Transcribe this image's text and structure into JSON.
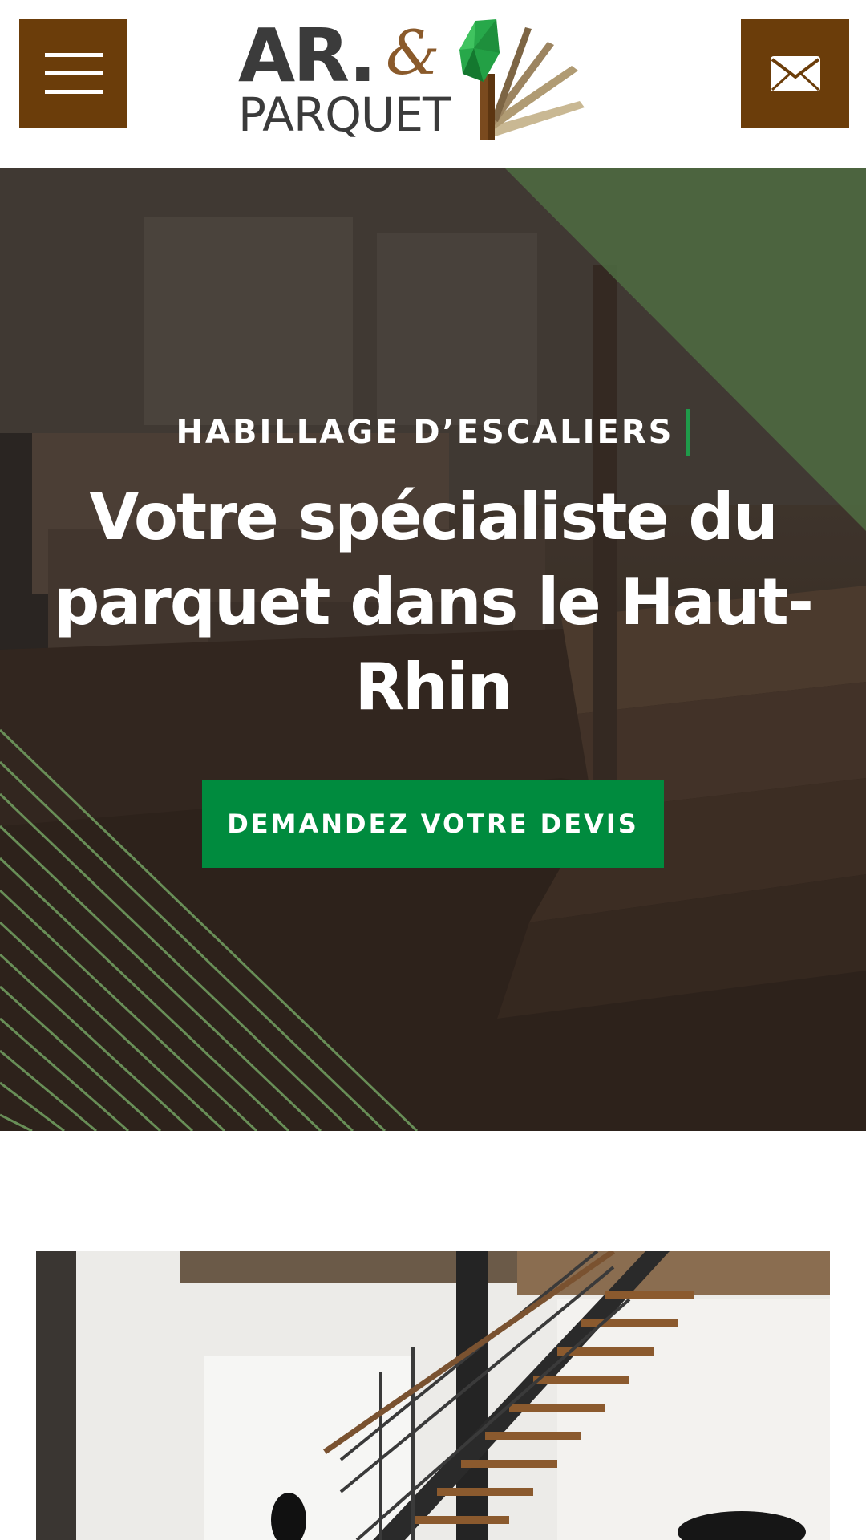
{
  "header": {
    "menu_icon": "hamburger-menu-icon",
    "contact_icon": "envelope-icon",
    "logo": {
      "ar": "AR.",
      "amp": "&",
      "parquet": "PARQUET"
    }
  },
  "hero": {
    "eyebrow": "HABILLAGE D’ESCALIERS",
    "title": "Votre spécialiste du parquet dans le Haut-Rhin",
    "cta_label": "DEMANDEZ VOTRE DEVIS"
  },
  "colors": {
    "brand_brown": "#6b3d0a",
    "brand_green": "#008b3e",
    "accent_green": "#1f9a4a",
    "logo_grey": "#3b3b3b"
  }
}
